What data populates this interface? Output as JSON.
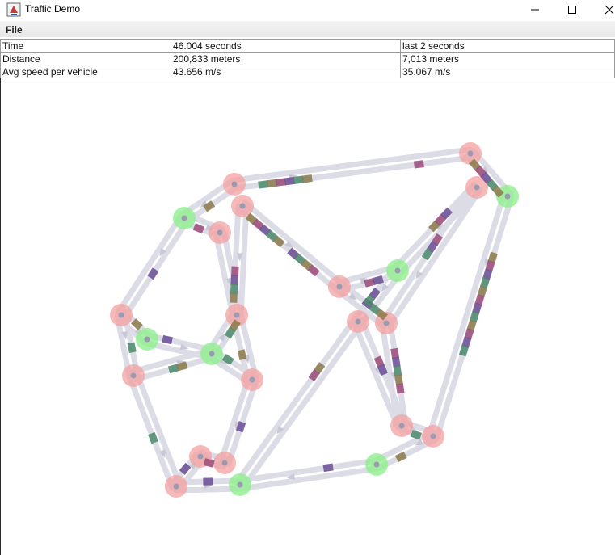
{
  "window": {
    "title": "Traffic Demo",
    "icon": "java-cup-icon",
    "controls": [
      "minimize-icon",
      "maximize-icon",
      "close-icon"
    ]
  },
  "menu": {
    "file_label": "File"
  },
  "stats": {
    "rows": [
      {
        "label": "Time",
        "total": "46.004 seconds",
        "recent": "last 2 seconds"
      },
      {
        "label": "Distance",
        "total": "200,833 meters",
        "recent": "7,013 meters"
      },
      {
        "label": "Avg speed per vehicle",
        "total": "43.656 m/s",
        "recent": "35.067 m/s"
      }
    ]
  },
  "colors": {
    "road": "#dcdce6",
    "intersection_red": "#f4a0a0",
    "intersection_green": "#90f090",
    "node": "#9a9ab0",
    "car_purple": "#6a4c93",
    "car_green": "#4a8a6a",
    "car_olive": "#8a7a4a",
    "car_magenta": "#9a4a78"
  }
}
